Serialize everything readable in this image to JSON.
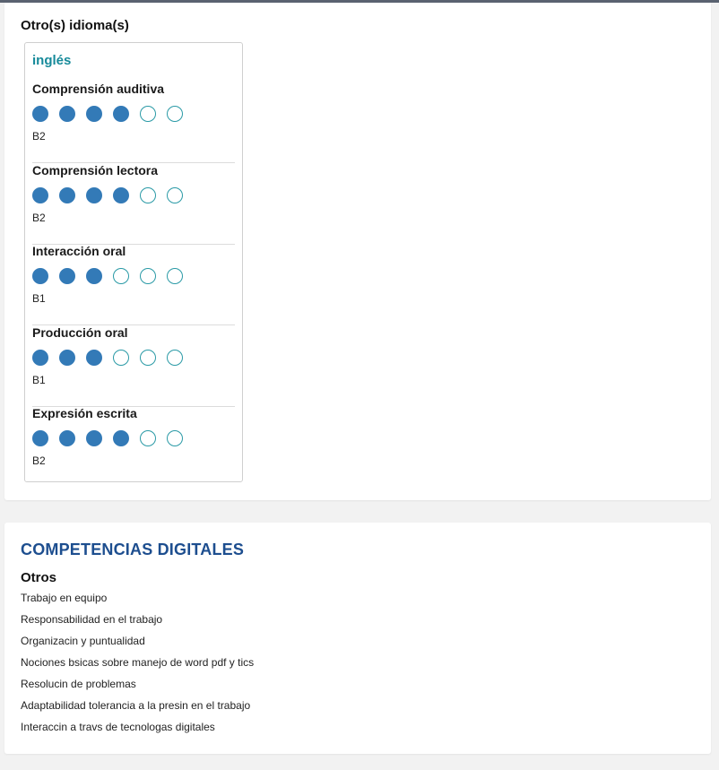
{
  "languages_section": {
    "heading": "Otro(s) idioma(s)",
    "language": "inglés",
    "skills": [
      {
        "title": "Comprensión auditiva",
        "filled": 4,
        "total": 6,
        "level": "B2"
      },
      {
        "title": "Comprensión lectora",
        "filled": 4,
        "total": 6,
        "level": "B2"
      },
      {
        "title": "Interacción oral",
        "filled": 3,
        "total": 6,
        "level": "B1"
      },
      {
        "title": "Producción oral",
        "filled": 3,
        "total": 6,
        "level": "B1"
      },
      {
        "title": "Expresión escrita",
        "filled": 4,
        "total": 6,
        "level": "B2"
      }
    ]
  },
  "digital_section": {
    "title": "COMPETENCIAS DIGITALES",
    "subheading": "Otros",
    "items": [
      "Trabajo en equipo",
      "Responsabilidad en el trabajo",
      "Organizacin y puntualidad",
      "Nociones bsicas sobre manejo de word pdf y tics",
      "Resolucin de problemas",
      "Adaptabilidad tolerancia a la presin en el trabajo",
      "Interaccin a travs de tecnologas digitales"
    ]
  },
  "colors": {
    "filled_dot": "#337ab7",
    "empty_dot_border": "#2a9aa6",
    "language_name": "#168a9a",
    "section_title": "#1d4e8f"
  }
}
